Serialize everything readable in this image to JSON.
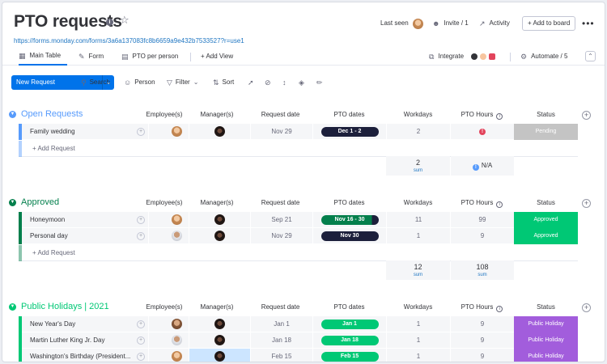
{
  "header": {
    "title": "PTO requests",
    "form_url": "https://forms.monday.com/forms/3a6a137083fc8b6659a9e432b7533527?r=use1",
    "last_seen_label": "Last seen",
    "invite_label": "Invite / 1",
    "activity_label": "Activity",
    "add_to_board_label": "+ Add to board",
    "more_label": "•••"
  },
  "tabs": [
    {
      "label": "Main Table",
      "icon": "table-icon"
    },
    {
      "label": "Form",
      "icon": "form-icon"
    },
    {
      "label": "PTO per person",
      "icon": "chart-icon"
    },
    {
      "label": "+ Add View"
    }
  ],
  "integrations": {
    "label": "Integrate",
    "icon_colors": [
      "#323338",
      "#f7c59f",
      "#e2445c"
    ]
  },
  "automate": {
    "label": "Automate / 5"
  },
  "toolbar": {
    "new_item_label": "New Request",
    "search_label": "Search",
    "person_label": "Person",
    "filter_label": "Filter",
    "sort_label": "Sort"
  },
  "columns": [
    "Employee(s)",
    "Manager(s)",
    "Request date",
    "PTO dates",
    "Workdays",
    "PTO Hours",
    "Status"
  ],
  "add_item_label": "+ Add Request",
  "colors": {
    "open": "#579bfc",
    "approved": "#037f4c",
    "holidays": "#00c875",
    "pill_dark": "#1c1f3b",
    "approved_status": "#00c875",
    "pending_status": "#c4c4c4",
    "holiday_status": "#a25ddc"
  },
  "groups": [
    {
      "title": "Open Requests",
      "rows": [
        {
          "name": "Family wedding",
          "request_date": "Nov 29",
          "pto_dates": "Dec 1 - 2",
          "workdays": "2",
          "pto_hours": "!",
          "status": "Pending"
        }
      ],
      "sum_workdays": "2",
      "sum_hours": "N/A",
      "sum_label": "sum"
    },
    {
      "title": "Approved",
      "rows": [
        {
          "name": "Honeymoon",
          "request_date": "Sep 21",
          "pto_dates": "Nov 16 - 30",
          "workdays": "11",
          "pto_hours": "99",
          "status": "Approved"
        },
        {
          "name": "Personal day",
          "request_date": "Nov 29",
          "pto_dates": "Nov 30",
          "workdays": "1",
          "pto_hours": "9",
          "status": "Approved"
        }
      ],
      "sum_workdays": "12",
      "sum_hours": "108",
      "sum_label": "sum"
    },
    {
      "title": "Public Holidays | 2021",
      "rows": [
        {
          "name": "New Year's Day",
          "request_date": "Jan 1",
          "pto_dates": "Jan 1",
          "workdays": "1",
          "pto_hours": "9",
          "status": "Public Holiday"
        },
        {
          "name": "Martin Luther King Jr. Day",
          "request_date": "Jan 18",
          "pto_dates": "Jan 18",
          "workdays": "1",
          "pto_hours": "9",
          "status": "Public Holiday"
        },
        {
          "name": "Washington's Birthday (President...",
          "request_date": "Feb 15",
          "pto_dates": "Feb 15",
          "workdays": "1",
          "pto_hours": "9",
          "status": "Public Holiday"
        }
      ]
    }
  ]
}
